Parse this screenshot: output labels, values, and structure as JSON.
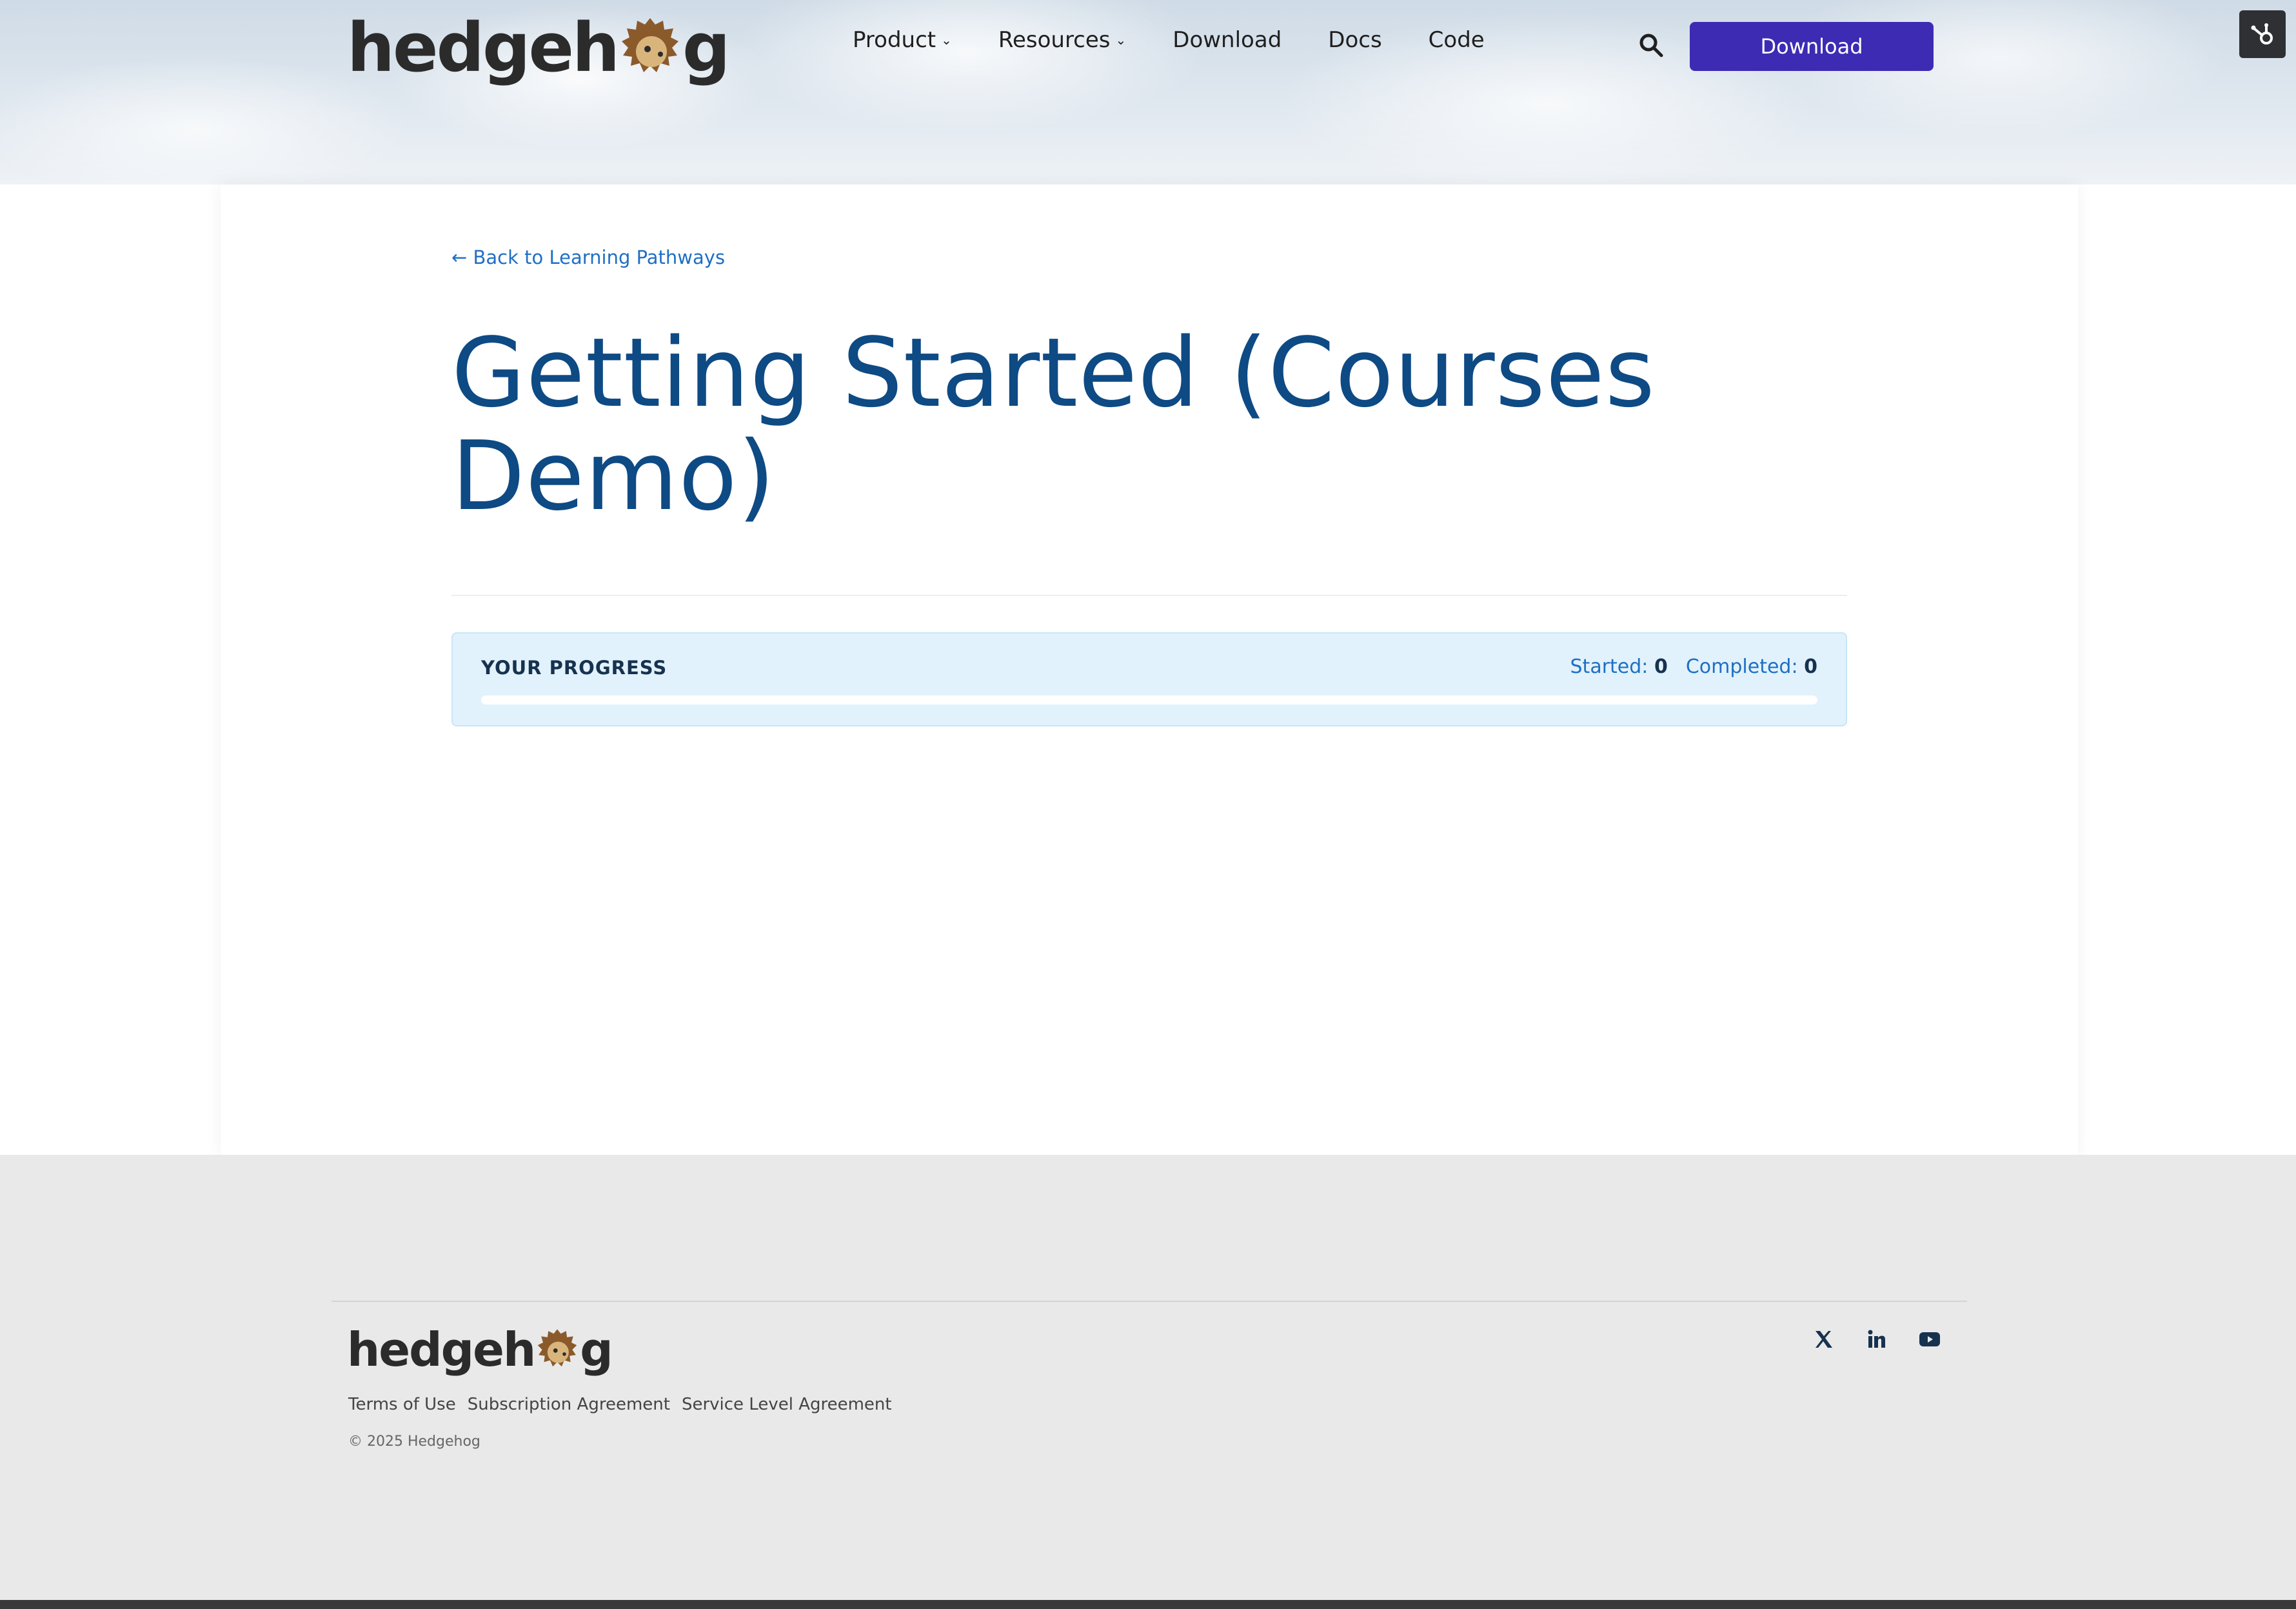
{
  "header": {
    "logo_text_start": "hedgeh",
    "logo_text_end": "g",
    "nav": [
      {
        "label": "Product",
        "has_dropdown": true
      },
      {
        "label": "Resources",
        "has_dropdown": true
      },
      {
        "label": "Download",
        "has_dropdown": false
      },
      {
        "label": "Docs",
        "has_dropdown": false
      },
      {
        "label": "Code",
        "has_dropdown": false
      }
    ],
    "download_button": "Download"
  },
  "main": {
    "back_link": "← Back to Learning Pathways",
    "title": "Getting Started (Courses Demo)",
    "progress": {
      "label": "YOUR PROGRESS",
      "started_label": "Started:",
      "started_value": "0",
      "completed_label": "Completed:",
      "completed_value": "0",
      "fraction": 0
    }
  },
  "footer": {
    "logo_text_start": "hedgeh",
    "logo_text_end": "g",
    "links": [
      "Terms of Use",
      "Subscription Agreement",
      "Service Level Agreement"
    ],
    "copyright": "© 2025 Hedgehog",
    "socials": [
      "x-icon",
      "linkedin-icon",
      "youtube-icon"
    ]
  },
  "colors": {
    "accent_button": "#3d2bb4",
    "title": "#0e4a84",
    "link": "#1f6fc4",
    "progress_bg": "#e1f2fc"
  }
}
